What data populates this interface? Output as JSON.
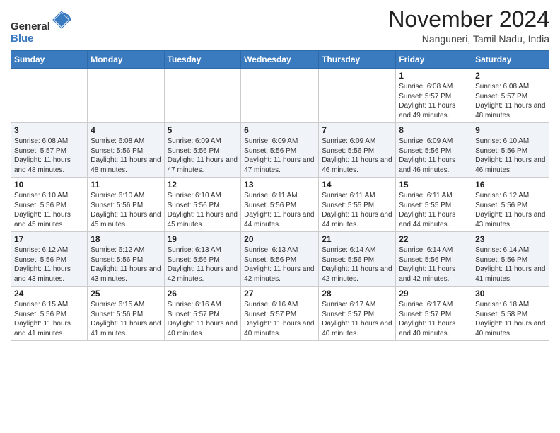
{
  "logo": {
    "general": "General",
    "blue": "Blue"
  },
  "header": {
    "month": "November 2024",
    "location": "Nanguneri, Tamil Nadu, India"
  },
  "weekdays": [
    "Sunday",
    "Monday",
    "Tuesday",
    "Wednesday",
    "Thursday",
    "Friday",
    "Saturday"
  ],
  "weeks": [
    [
      {
        "day": "",
        "sunrise": "",
        "sunset": "",
        "daylight": ""
      },
      {
        "day": "",
        "sunrise": "",
        "sunset": "",
        "daylight": ""
      },
      {
        "day": "",
        "sunrise": "",
        "sunset": "",
        "daylight": ""
      },
      {
        "day": "",
        "sunrise": "",
        "sunset": "",
        "daylight": ""
      },
      {
        "day": "",
        "sunrise": "",
        "sunset": "",
        "daylight": ""
      },
      {
        "day": "1",
        "sunrise": "Sunrise: 6:08 AM",
        "sunset": "Sunset: 5:57 PM",
        "daylight": "Daylight: 11 hours and 49 minutes."
      },
      {
        "day": "2",
        "sunrise": "Sunrise: 6:08 AM",
        "sunset": "Sunset: 5:57 PM",
        "daylight": "Daylight: 11 hours and 48 minutes."
      }
    ],
    [
      {
        "day": "3",
        "sunrise": "Sunrise: 6:08 AM",
        "sunset": "Sunset: 5:57 PM",
        "daylight": "Daylight: 11 hours and 48 minutes."
      },
      {
        "day": "4",
        "sunrise": "Sunrise: 6:08 AM",
        "sunset": "Sunset: 5:56 PM",
        "daylight": "Daylight: 11 hours and 48 minutes."
      },
      {
        "day": "5",
        "sunrise": "Sunrise: 6:09 AM",
        "sunset": "Sunset: 5:56 PM",
        "daylight": "Daylight: 11 hours and 47 minutes."
      },
      {
        "day": "6",
        "sunrise": "Sunrise: 6:09 AM",
        "sunset": "Sunset: 5:56 PM",
        "daylight": "Daylight: 11 hours and 47 minutes."
      },
      {
        "day": "7",
        "sunrise": "Sunrise: 6:09 AM",
        "sunset": "Sunset: 5:56 PM",
        "daylight": "Daylight: 11 hours and 46 minutes."
      },
      {
        "day": "8",
        "sunrise": "Sunrise: 6:09 AM",
        "sunset": "Sunset: 5:56 PM",
        "daylight": "Daylight: 11 hours and 46 minutes."
      },
      {
        "day": "9",
        "sunrise": "Sunrise: 6:10 AM",
        "sunset": "Sunset: 5:56 PM",
        "daylight": "Daylight: 11 hours and 46 minutes."
      }
    ],
    [
      {
        "day": "10",
        "sunrise": "Sunrise: 6:10 AM",
        "sunset": "Sunset: 5:56 PM",
        "daylight": "Daylight: 11 hours and 45 minutes."
      },
      {
        "day": "11",
        "sunrise": "Sunrise: 6:10 AM",
        "sunset": "Sunset: 5:56 PM",
        "daylight": "Daylight: 11 hours and 45 minutes."
      },
      {
        "day": "12",
        "sunrise": "Sunrise: 6:10 AM",
        "sunset": "Sunset: 5:56 PM",
        "daylight": "Daylight: 11 hours and 45 minutes."
      },
      {
        "day": "13",
        "sunrise": "Sunrise: 6:11 AM",
        "sunset": "Sunset: 5:56 PM",
        "daylight": "Daylight: 11 hours and 44 minutes."
      },
      {
        "day": "14",
        "sunrise": "Sunrise: 6:11 AM",
        "sunset": "Sunset: 5:55 PM",
        "daylight": "Daylight: 11 hours and 44 minutes."
      },
      {
        "day": "15",
        "sunrise": "Sunrise: 6:11 AM",
        "sunset": "Sunset: 5:55 PM",
        "daylight": "Daylight: 11 hours and 44 minutes."
      },
      {
        "day": "16",
        "sunrise": "Sunrise: 6:12 AM",
        "sunset": "Sunset: 5:56 PM",
        "daylight": "Daylight: 11 hours and 43 minutes."
      }
    ],
    [
      {
        "day": "17",
        "sunrise": "Sunrise: 6:12 AM",
        "sunset": "Sunset: 5:56 PM",
        "daylight": "Daylight: 11 hours and 43 minutes."
      },
      {
        "day": "18",
        "sunrise": "Sunrise: 6:12 AM",
        "sunset": "Sunset: 5:56 PM",
        "daylight": "Daylight: 11 hours and 43 minutes."
      },
      {
        "day": "19",
        "sunrise": "Sunrise: 6:13 AM",
        "sunset": "Sunset: 5:56 PM",
        "daylight": "Daylight: 11 hours and 42 minutes."
      },
      {
        "day": "20",
        "sunrise": "Sunrise: 6:13 AM",
        "sunset": "Sunset: 5:56 PM",
        "daylight": "Daylight: 11 hours and 42 minutes."
      },
      {
        "day": "21",
        "sunrise": "Sunrise: 6:14 AM",
        "sunset": "Sunset: 5:56 PM",
        "daylight": "Daylight: 11 hours and 42 minutes."
      },
      {
        "day": "22",
        "sunrise": "Sunrise: 6:14 AM",
        "sunset": "Sunset: 5:56 PM",
        "daylight": "Daylight: 11 hours and 42 minutes."
      },
      {
        "day": "23",
        "sunrise": "Sunrise: 6:14 AM",
        "sunset": "Sunset: 5:56 PM",
        "daylight": "Daylight: 11 hours and 41 minutes."
      }
    ],
    [
      {
        "day": "24",
        "sunrise": "Sunrise: 6:15 AM",
        "sunset": "Sunset: 5:56 PM",
        "daylight": "Daylight: 11 hours and 41 minutes."
      },
      {
        "day": "25",
        "sunrise": "Sunrise: 6:15 AM",
        "sunset": "Sunset: 5:56 PM",
        "daylight": "Daylight: 11 hours and 41 minutes."
      },
      {
        "day": "26",
        "sunrise": "Sunrise: 6:16 AM",
        "sunset": "Sunset: 5:57 PM",
        "daylight": "Daylight: 11 hours and 40 minutes."
      },
      {
        "day": "27",
        "sunrise": "Sunrise: 6:16 AM",
        "sunset": "Sunset: 5:57 PM",
        "daylight": "Daylight: 11 hours and 40 minutes."
      },
      {
        "day": "28",
        "sunrise": "Sunrise: 6:17 AM",
        "sunset": "Sunset: 5:57 PM",
        "daylight": "Daylight: 11 hours and 40 minutes."
      },
      {
        "day": "29",
        "sunrise": "Sunrise: 6:17 AM",
        "sunset": "Sunset: 5:57 PM",
        "daylight": "Daylight: 11 hours and 40 minutes."
      },
      {
        "day": "30",
        "sunrise": "Sunrise: 6:18 AM",
        "sunset": "Sunset: 5:58 PM",
        "daylight": "Daylight: 11 hours and 40 minutes."
      }
    ]
  ]
}
